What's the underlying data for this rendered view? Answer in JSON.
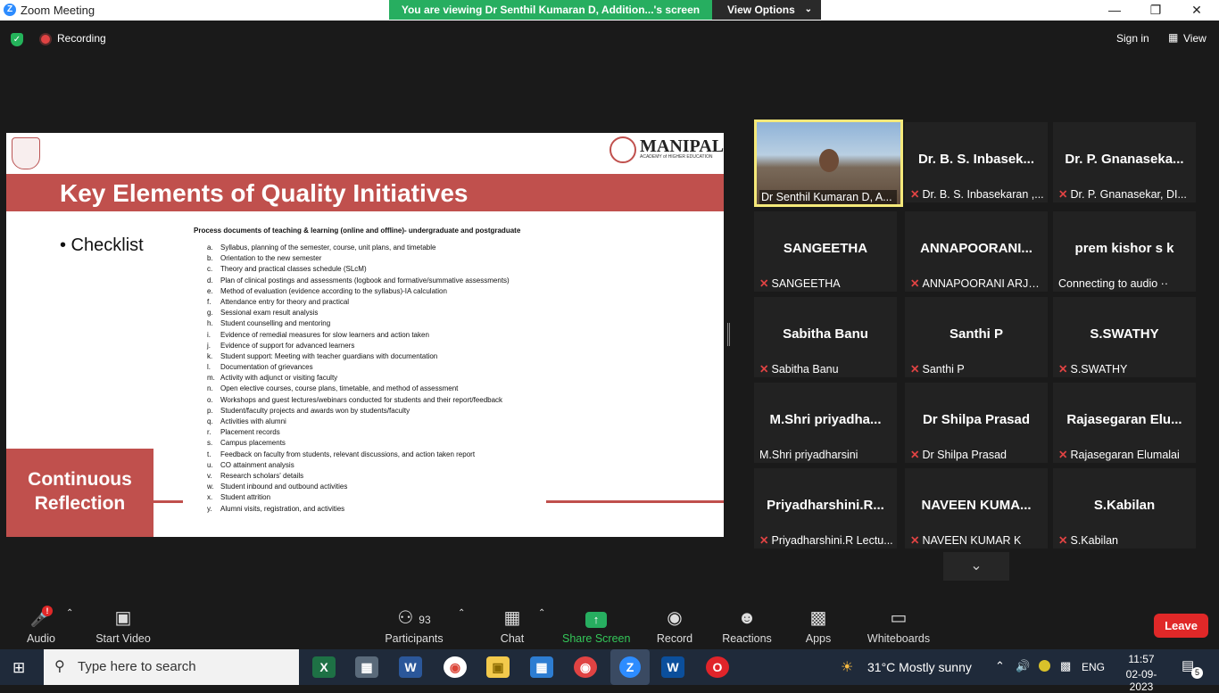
{
  "window": {
    "title": "Zoom Meeting"
  },
  "banner": {
    "text": "You are viewing Dr Senthil Kumaran D, Addition...'s screen",
    "view_options": "View Options"
  },
  "topbar": {
    "recording": "Recording",
    "sign_in": "Sign in",
    "view": "View"
  },
  "slide": {
    "title": "Key Elements of Quality Initiatives",
    "bullet": "• Checklist",
    "heading": "Process documents of teaching & learning (online and offline)- undergraduate and postgraduate",
    "logo_name": "MANIPAL",
    "logo_sub": "ACADEMY of HIGHER EDUCATION",
    "items": [
      {
        "k": "a.",
        "t": "Syllabus, planning of the semester, course, unit plans, and timetable"
      },
      {
        "k": "b.",
        "t": "Orientation to the new semester"
      },
      {
        "k": "c.",
        "t": "Theory and practical classes schedule (SLcM)"
      },
      {
        "k": "d.",
        "t": "Plan of clinical postings and assessments (logbook and formative/summative assessments)"
      },
      {
        "k": "e.",
        "t": "Method of evaluation (evidence according to the syllabus)-IA calculation"
      },
      {
        "k": "f.",
        "t": "Attendance entry for theory and practical"
      },
      {
        "k": "g.",
        "t": "Sessional exam result analysis"
      },
      {
        "k": "h.",
        "t": "Student counselling and mentoring"
      },
      {
        "k": "i.",
        "t": "Evidence of remedial measures for slow learners and action taken"
      },
      {
        "k": "j.",
        "t": "Evidence of support for advanced learners"
      },
      {
        "k": "k.",
        "t": "Student support: Meeting with teacher guardians with documentation"
      },
      {
        "k": "l.",
        "t": "Documentation of grievances"
      },
      {
        "k": "m.",
        "t": "Activity with adjunct or visiting faculty"
      },
      {
        "k": "n.",
        "t": "Open elective courses, course plans, timetable, and method of assessment"
      },
      {
        "k": "o.",
        "t": "Workshops and guest lectures/webinars conducted for students and their report/feedback"
      },
      {
        "k": "p.",
        "t": "Student/faculty projects and awards won by students/faculty"
      },
      {
        "k": "q.",
        "t": "Activities with alumni"
      },
      {
        "k": "r.",
        "t": "Placement records"
      },
      {
        "k": "s.",
        "t": "Campus placements"
      },
      {
        "k": "t.",
        "t": "Feedback on faculty from students, relevant discussions, and action taken report"
      },
      {
        "k": "u.",
        "t": "CO attainment analysis"
      },
      {
        "k": "v.",
        "t": "Research scholars' details"
      },
      {
        "k": "w.",
        "t": "Student inbound and outbound activities"
      },
      {
        "k": "x.",
        "t": "Student attrition"
      },
      {
        "k": "y.",
        "t": "Alumni visits, registration, and activities"
      }
    ],
    "callout": "Continuous Reflection"
  },
  "participants_grid": [
    {
      "name": "",
      "label": "Dr Senthil Kumaran D, A...",
      "muted": false,
      "active": true
    },
    {
      "name": "Dr. B. S. Inbasek...",
      "label": "Dr. B. S. Inbasekaran ,...",
      "muted": true
    },
    {
      "name": "Dr. P. Gnanaseka...",
      "label": "Dr. P. Gnanasekar, DI...",
      "muted": true
    },
    {
      "name": "SANGEETHA",
      "label": "SANGEETHA",
      "muted": true
    },
    {
      "name": "ANNAPOORANI...",
      "label": "ANNAPOORANI ARJU...",
      "muted": true
    },
    {
      "name": "prem kishor s k",
      "label": "Connecting to audio ··",
      "muted": false
    },
    {
      "name": "Sabitha Banu",
      "label": "Sabitha Banu",
      "muted": true
    },
    {
      "name": "Santhi P",
      "label": "Santhi P",
      "muted": true
    },
    {
      "name": "S.SWATHY",
      "label": "S.SWATHY",
      "muted": true
    },
    {
      "name": "M.Shri  priyadha...",
      "label": "M.Shri priyadharsini",
      "muted": false
    },
    {
      "name": "Dr Shilpa Prasad",
      "label": "Dr Shilpa Prasad",
      "muted": true
    },
    {
      "name": "Rajasegaran  Elu...",
      "label": "Rajasegaran Elumalai",
      "muted": true
    },
    {
      "name": "Priyadharshini.R...",
      "label": "Priyadharshini.R Lectu...",
      "muted": true
    },
    {
      "name": "NAVEEN  KUMA...",
      "label": "NAVEEN KUMAR K",
      "muted": true
    },
    {
      "name": "S.Kabilan",
      "label": "S.Kabilan",
      "muted": true
    }
  ],
  "toolbar": {
    "audio": "Audio",
    "video": "Start Video",
    "participants": "Participants",
    "participants_count": "93",
    "chat": "Chat",
    "share": "Share Screen",
    "record": "Record",
    "reactions": "Reactions",
    "apps": "Apps",
    "whiteboards": "Whiteboards",
    "leave": "Leave",
    "audio_badge": "!"
  },
  "taskbar": {
    "search_placeholder": "Type here to search",
    "weather": "31°C  Mostly sunny",
    "lang": "ENG",
    "time": "11:57",
    "date": "02-09-2023",
    "notifications": "5"
  },
  "colors": {
    "accent": "#c0504d",
    "zoom_blue": "#2d8cff",
    "share_green": "#27ae60",
    "leave_red": "#e02828"
  }
}
